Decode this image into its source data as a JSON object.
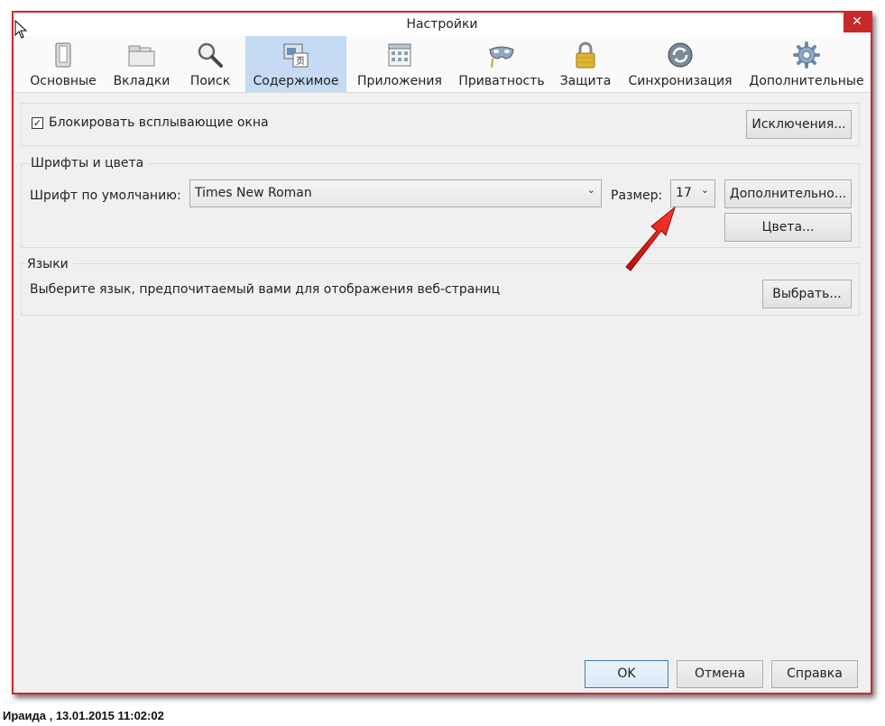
{
  "window": {
    "title": "Настройки",
    "close_label": "✕"
  },
  "tabs": [
    {
      "label": "Основные",
      "icon": "general-switch-icon",
      "active": false
    },
    {
      "label": "Вкладки",
      "icon": "tabs-icon",
      "active": false
    },
    {
      "label": "Поиск",
      "icon": "magnifier-icon",
      "active": false
    },
    {
      "label": "Содержимое",
      "icon": "content-icon",
      "active": true
    },
    {
      "label": "Приложения",
      "icon": "applications-icon",
      "active": false
    },
    {
      "label": "Приватность",
      "icon": "privacy-mask-icon",
      "active": false
    },
    {
      "label": "Защита",
      "icon": "padlock-icon",
      "active": false
    },
    {
      "label": "Синхронизация",
      "icon": "sync-icon",
      "active": false
    },
    {
      "label": "Дополнительные",
      "icon": "gear-icon",
      "active": false
    }
  ],
  "popups": {
    "checkbox_label": "Блокировать всплывающие окна",
    "checked": true,
    "exceptions_button": "Исключения..."
  },
  "fonts": {
    "group_title": "Шрифты и цвета",
    "default_font_label": "Шрифт по умолчанию:",
    "default_font_value": "Times New Roman",
    "size_label": "Размер:",
    "size_value": "17",
    "advanced_button": "Дополнительно...",
    "colors_button": "Цвета..."
  },
  "languages": {
    "group_title": "Языки",
    "description": "Выберите язык, предпочитаемый вами для отображения веб-страниц",
    "choose_button": "Выбрать..."
  },
  "buttons": {
    "ok": "OK",
    "cancel": "Отмена",
    "help": "Справка"
  },
  "caption": "Ираида  ,  13.01.2015 11:02:02",
  "colors": {
    "window_border": "#d5242c",
    "active_tab": "#c5daf3",
    "arrow": "#e01b1b"
  }
}
